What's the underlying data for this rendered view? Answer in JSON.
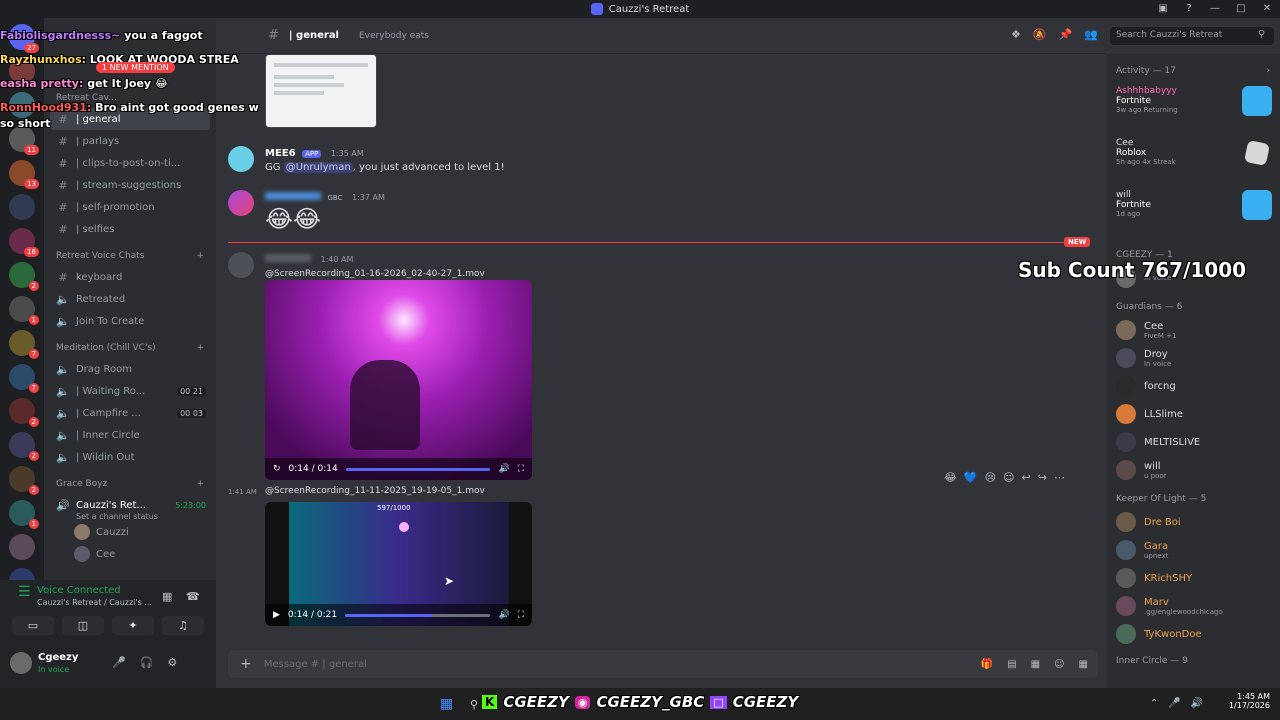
{
  "window": {
    "title": "Cauzzi's Retreat",
    "controls": [
      "—",
      "□",
      "✕"
    ]
  },
  "header": {
    "channel": "| general",
    "topic": "Everybody eats",
    "search_placeholder": "Search Cauzzi's Retreat"
  },
  "overlay_chat": [
    {
      "name": "Fabiolisgardnesss~",
      "text": "you a faggot"
    },
    {
      "name": "Rayzhunxhos:",
      "text": "LOOK AT WOODA STREA"
    },
    {
      "name": "easha pretty:",
      "text": "get It Joey 😂"
    },
    {
      "name": "RonnHood931:",
      "text": "Bro aint got good genes w"
    },
    {
      "name": "",
      "text": "so short"
    }
  ],
  "new_mention": "1 NEW MENTION",
  "sub_count": "Sub Count 767/1000",
  "channels": {
    "top_category": "Retreat Cav...",
    "selected": "| general",
    "text": [
      "| parlays",
      "| clips-to-post-on-ti...",
      "| stream-suggestions",
      "| self-promotion",
      "| selfies"
    ],
    "voice_category": "Retreat Voice Chats",
    "voice": [
      "keyboard",
      "Retreated",
      "Join To Create"
    ],
    "meditation_category": "Meditation (Chill VC's)",
    "meditation": [
      {
        "name": "Drag Room",
        "tag": ""
      },
      {
        "name": "| Waiting Ro...",
        "tag": "00 21"
      },
      {
        "name": "| Campfire ...",
        "tag": "00 03"
      },
      {
        "name": "| Inner Circle",
        "tag": ""
      },
      {
        "name": "| Wildin Out",
        "tag": ""
      }
    ],
    "grace_category": "Grace Boyz",
    "active_vc": "Cauzzi's Ret...",
    "active_vc_time": "5:23:00",
    "channel_status": "Set a channel status",
    "vc_members": [
      "Cauzzi",
      "Cee"
    ]
  },
  "voice_panel": {
    "status": "Voice Connected",
    "location": "Cauzzi's Retreat / Cauzzi's ..."
  },
  "user": {
    "name": "Cgeezy",
    "status": "In voice"
  },
  "messages": {
    "mee6": {
      "name": "MEE6",
      "tag": "APP",
      "time": "1:35 AM",
      "text_pre": "GG ",
      "mention": "@Unrulyman",
      "text_post": ", you just advanced to level 1!"
    },
    "emoji_msg": {
      "tag": "GBC",
      "time": "1:37 AM",
      "emoji": "😂😂"
    },
    "new_label": "NEW",
    "video1": {
      "time": "1:40 AM",
      "file": "ScreenRecording_01-16-2026_02-40-27_1.mov",
      "duration": "0:14 / 0:14",
      "progress": 1.0
    },
    "video2": {
      "time": "1:41 AM",
      "file": "ScreenRecording_11-11-2025_19-19-05_1.mov",
      "duration": "0:14 / 0:21",
      "progress": 0.6,
      "overlay_count": "597/1000"
    }
  },
  "composer": {
    "placeholder": "Message # | general"
  },
  "activity": {
    "title": "Activity — 17",
    "items": [
      {
        "name": "Ashhhbabyyy",
        "game": "Fortnite",
        "meta": "3w ago  Returning"
      },
      {
        "name": "Cee",
        "game": "Roblox",
        "meta": "5h ago  4x Streak"
      },
      {
        "name": "will",
        "game": "Fortnite",
        "meta": "1d ago"
      }
    ]
  },
  "members": {
    "cgeezy_section": "CGEEZY — 1",
    "cgeezy_status": "In voice",
    "guardians_title": "Guardians — 6",
    "guardians": [
      {
        "name": "Cee",
        "sub": "FiveM +1",
        "color": "#dbdee1"
      },
      {
        "name": "Droy",
        "sub": "In voice",
        "color": "#dbdee1"
      },
      {
        "name": "forcng",
        "sub": "",
        "color": "#dbdee1"
      },
      {
        "name": "LLSlime",
        "sub": "",
        "color": "#dbdee1"
      },
      {
        "name": "MELTISLIVE",
        "sub": "",
        "color": "#dbdee1"
      },
      {
        "name": "will",
        "sub": "u poor",
        "color": "#dbdee1"
      }
    ],
    "keeper_title": "Keeper Of Light — 5",
    "keepers": [
      {
        "name": "Dre Boi",
        "sub": "",
        "color": "#f0a04b"
      },
      {
        "name": "Gara",
        "sub": "upnext",
        "color": "#f0a04b"
      },
      {
        "name": "KRichSHY",
        "sub": "",
        "color": "#f0a04b"
      },
      {
        "name": "Marv",
        "sub": ".gg/englewoodchicago",
        "color": "#f0a04b"
      },
      {
        "name": "TyKwonDoe",
        "sub": "",
        "color": "#f0a04b"
      }
    ],
    "inner_title": "Inner Circle — 9"
  },
  "taskbar": {
    "socials": [
      "CGEEZY",
      "CGEEZY_GBC",
      "CGEEZY"
    ],
    "time": "1:45 AM",
    "date": "1/17/2026"
  },
  "colors": {
    "accent": "#5865f2",
    "new_red": "#f23f43",
    "green": "#23a55a"
  }
}
